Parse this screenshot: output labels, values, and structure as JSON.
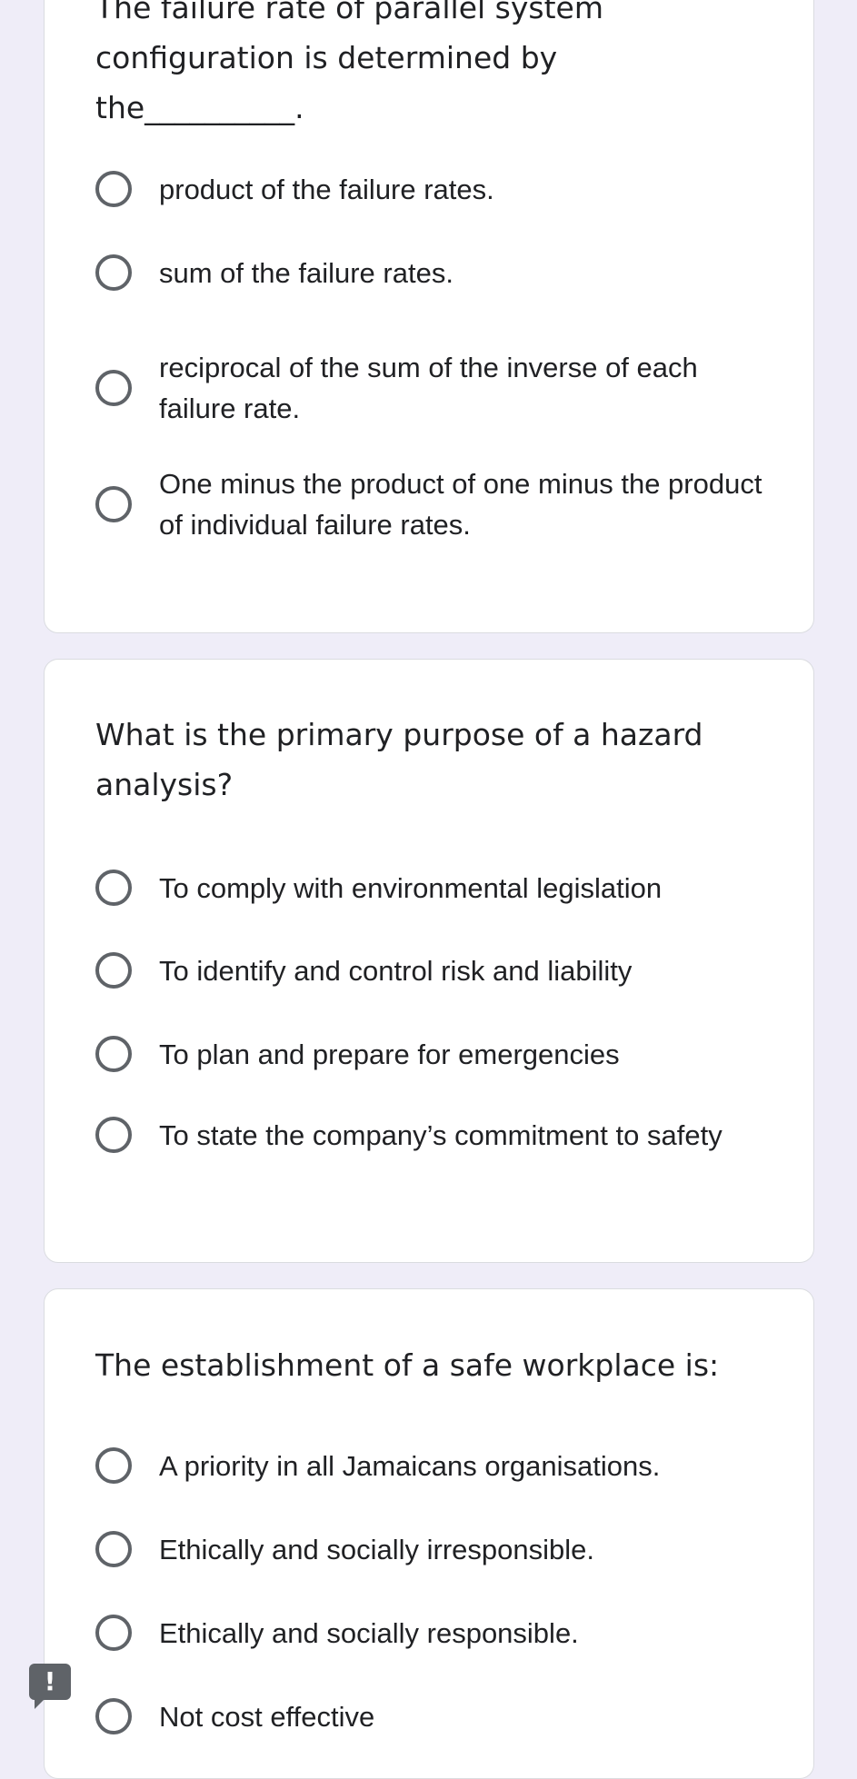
{
  "questions": [
    {
      "text": "The failure rate of parallel system\nconfiguration is determined by\nthe__________.",
      "options": [
        "product of the failure rates.",
        "sum of the failure rates.",
        "reciprocal of the sum of the inverse of each failure rate.",
        "One minus the product of one minus the product of individual failure rates."
      ]
    },
    {
      "text": "What is the primary purpose of a hazard\nanalysis?",
      "options": [
        "To comply with environmental legislation",
        "To identify and control risk and liability",
        "To plan and prepare for emergencies",
        "To state the company’s commitment to safety"
      ]
    },
    {
      "text": "The establishment of a safe workplace is:",
      "options": [
        "A priority in all Jamaicans organisations.",
        "Ethically and socially irresponsible.",
        "Ethically and socially responsible.",
        "Not cost effective"
      ]
    }
  ],
  "report_button": {
    "label": "!",
    "icon": "exclamation-feedback-icon"
  }
}
